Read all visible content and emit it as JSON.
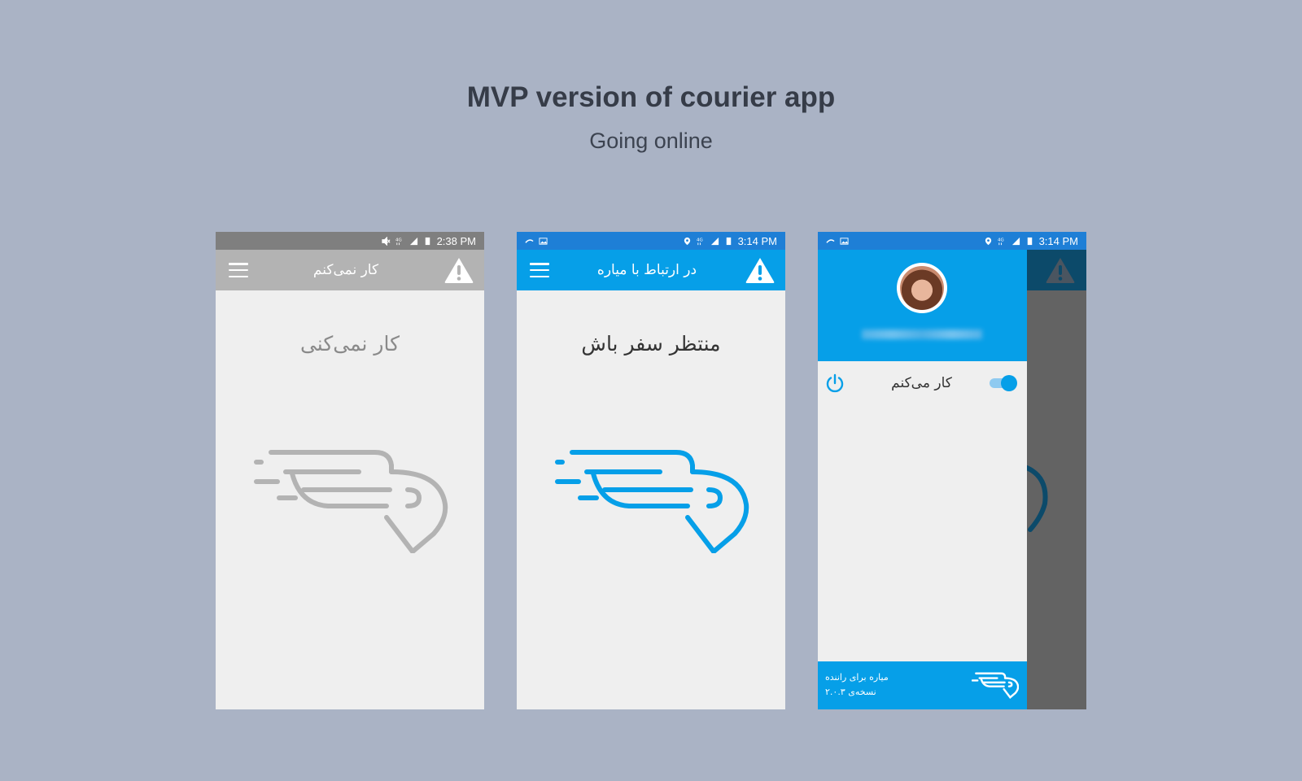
{
  "header": {
    "title": "MVP version of courier app",
    "subtitle": "Going online"
  },
  "colors": {
    "background": "#aab3c5",
    "offline_gray": "#b3b3b3",
    "online_blue": "#069fe8",
    "status_blue": "#1e7fd6"
  },
  "screens": [
    {
      "status_time": "2:38 PM",
      "appbar_title": "کار نمی‌کنم",
      "heading": "کار نمی‌کنی",
      "state": "offline",
      "icons": [
        "menu-icon",
        "alert-icon",
        "courier-logo-icon"
      ]
    },
    {
      "status_time": "3:14 PM",
      "appbar_title": "در ارتباط با میاره",
      "heading": "منتظر سفر باش",
      "state": "online",
      "icons": [
        "menu-icon",
        "alert-icon",
        "courier-logo-icon"
      ]
    },
    {
      "status_time": "3:14 PM",
      "state": "drawer-open",
      "drawer": {
        "toggle_label": "کار می‌کنم",
        "toggle_on": true,
        "footer_line1": "میاره برای راننده",
        "footer_line2": "نسخه‌ی ۲.۰.۳"
      },
      "icons": [
        "avatar",
        "power-icon",
        "toggle-switch",
        "courier-logo-icon"
      ]
    }
  ]
}
